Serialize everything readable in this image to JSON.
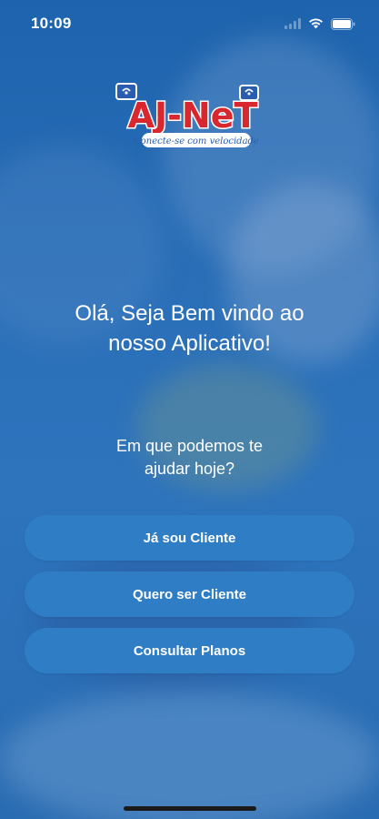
{
  "status_bar": {
    "time": "10:09"
  },
  "logo": {
    "brand_text": "AJ-NeT",
    "tagline": "Conecte-se com velocidade"
  },
  "welcome": {
    "line1": "Olá, Seja Bem vindo ao",
    "line2": "nosso Aplicativo!"
  },
  "question": {
    "line1": "Em que podemos te",
    "line2": "ajudar hoje?"
  },
  "buttons": {
    "existing_client": "Já sou Cliente",
    "become_client": "Quero ser Cliente",
    "view_plans": "Consultar Planos"
  },
  "colors": {
    "background": "#2a6fb8",
    "button": "#2f7ec5",
    "logo_red": "#d8272f",
    "logo_blue": "#2a5db0"
  },
  "icons": [
    "signal-icon",
    "wifi-icon",
    "battery-icon"
  ]
}
